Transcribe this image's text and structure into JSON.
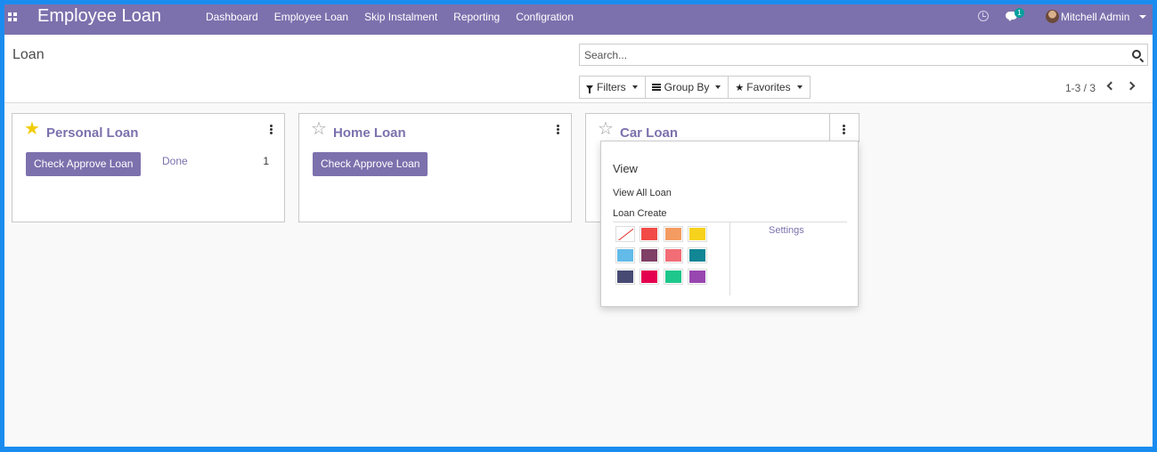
{
  "navbar": {
    "app_title": "Employee Loan",
    "menu": [
      "Dashboard",
      "Employee Loan",
      "Skip Instalment",
      "Reporting",
      "Configration"
    ],
    "chat_badge": "1",
    "user_name": "Mitchell Admin"
  },
  "control": {
    "breadcrumb": "Loan",
    "search_placeholder": "Search...",
    "filters_label": "Filters",
    "group_by_label": "Group By",
    "favorites_label": "Favorites",
    "pager": "1-3 / 3"
  },
  "cards": [
    {
      "title": "Personal Loan",
      "favorite": true,
      "button": "Check Approve Loan",
      "done_label": "Done",
      "done_count": "1"
    },
    {
      "title": "Home Loan",
      "favorite": false,
      "button": "Check Approve Loan"
    },
    {
      "title": "Car Loan",
      "favorite": false
    }
  ],
  "dropdown": {
    "view": "View",
    "view_all": "View All Loan",
    "create": "Loan Create",
    "settings": "Settings",
    "colors": [
      "none",
      "#f24b47",
      "#f49b61",
      "#f6d21c",
      "#63bbe9",
      "#7f3f66",
      "#f26d75",
      "#118694",
      "#474b73",
      "#e4004f",
      "#1ec78b",
      "#9847b0"
    ]
  }
}
